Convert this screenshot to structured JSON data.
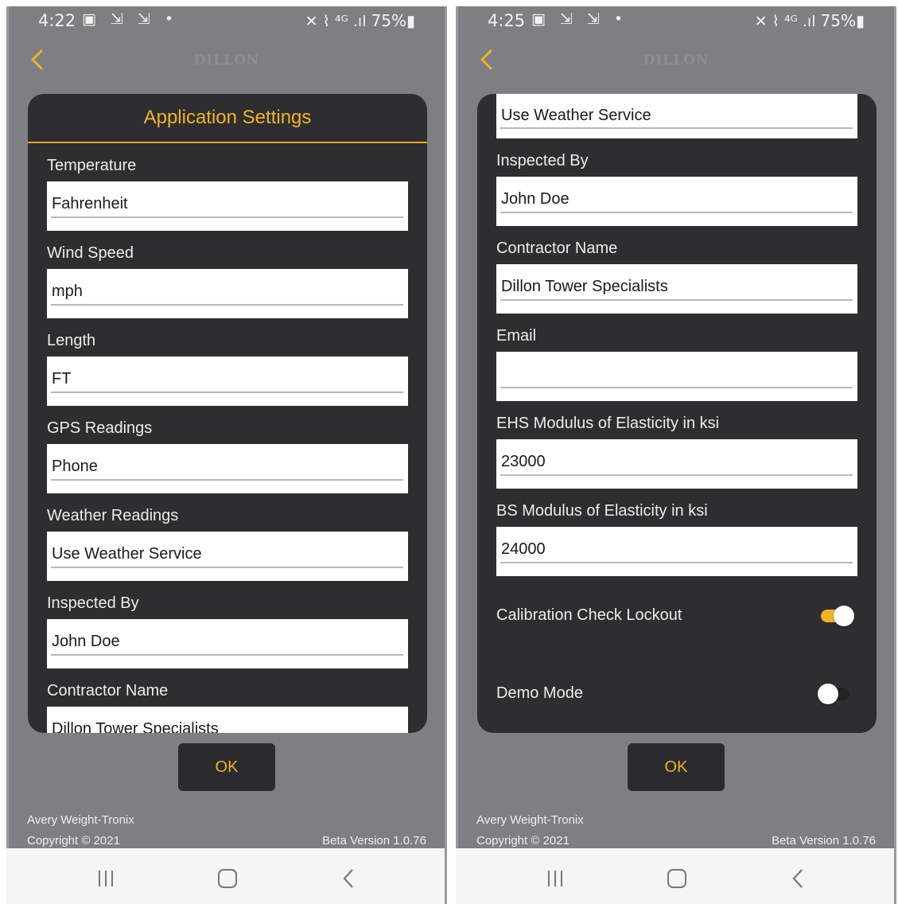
{
  "brand": "DILLON",
  "colors": {
    "accent": "#f0b323",
    "card": "#2e2e30",
    "background": "#7e7f82"
  },
  "icons": {
    "back": "chevron-left-icon",
    "toggle": "toggle-switch-icon"
  },
  "left": {
    "status": {
      "time": "4:22",
      "left_icons": "▣ ⇲ ⇲ •",
      "right_icons": "✕ ⌇ ⁴ᴳ .ıl",
      "battery": "75%▮"
    },
    "dialog_title": "Application Settings",
    "fields": [
      {
        "label": "Temperature",
        "value": "Fahrenheit"
      },
      {
        "label": "Wind Speed",
        "value": "mph"
      },
      {
        "label": "Length",
        "value": "FT"
      },
      {
        "label": "GPS Readings",
        "value": "Phone"
      },
      {
        "label": "Weather Readings",
        "value": "Use Weather Service"
      },
      {
        "label": "Inspected By",
        "value": "John Doe"
      },
      {
        "label": "Contractor Name",
        "value": "Dillon Tower Specialists"
      }
    ],
    "ok_label": "OK",
    "footer": {
      "company": "Avery Weight-Tronix",
      "copyright": "Copyright © 2021",
      "version": "Beta Version 1.0.76"
    }
  },
  "right": {
    "status": {
      "time": "4:25",
      "left_icons": "▣ ⇲ ⇲ •",
      "right_icons": "✕ ⌇ ⁴ᴳ .ıl",
      "battery": "75%▮"
    },
    "top_field": {
      "value": "Use Weather Service"
    },
    "fields": [
      {
        "label": "Inspected By",
        "value": "John Doe"
      },
      {
        "label": "Contractor Name",
        "value": "Dillon Tower Specialists"
      },
      {
        "label": "Email",
        "value": ""
      },
      {
        "label": "EHS Modulus of Elasticity in ksi",
        "value": "23000"
      },
      {
        "label": "BS Modulus of Elasticity in ksi",
        "value": "24000"
      }
    ],
    "toggles": [
      {
        "label": "Calibration Check Lockout",
        "state": "on"
      },
      {
        "label": "Demo Mode",
        "state": "off"
      }
    ],
    "ok_label": "OK",
    "footer": {
      "company": "Avery Weight-Tronix",
      "copyright": "Copyright © 2021",
      "version": "Beta Version 1.0.76"
    }
  }
}
